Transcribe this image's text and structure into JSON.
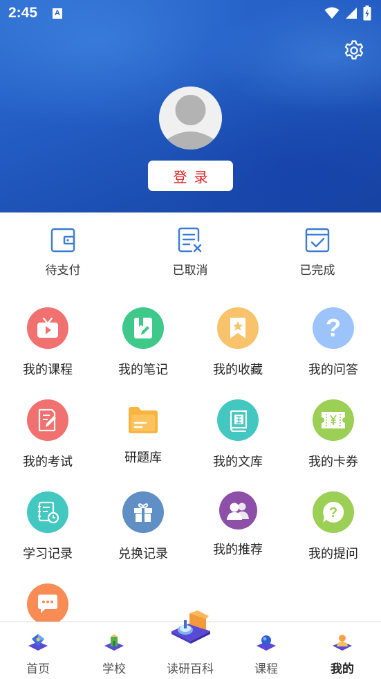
{
  "status_bar": {
    "time": "2:45",
    "notification_icon_letter": "A"
  },
  "header": {
    "settings_icon": "gear-icon",
    "avatar_icon": "default-user-avatar-icon",
    "login_label": "登录",
    "login_color": "#e02020"
  },
  "orders": [
    {
      "label": "待支付",
      "icon": "wallet-icon"
    },
    {
      "label": "已取消",
      "icon": "document-cancel-icon"
    },
    {
      "label": "已完成",
      "icon": "check-box-icon"
    }
  ],
  "menu": [
    {
      "label": "我的课程",
      "icon": "tv-play-icon",
      "color": "#f0716f"
    },
    {
      "label": "我的笔记",
      "icon": "notebook-pen-icon",
      "color": "#3ec98a"
    },
    {
      "label": "我的收藏",
      "icon": "bookmark-star-icon",
      "color": "#f8c36a"
    },
    {
      "label": "我的问答",
      "icon": "question-icon",
      "color": "#9cc4fb"
    },
    {
      "label": "我的考试",
      "icon": "exam-paper-icon",
      "color": "#f0716f"
    },
    {
      "label": "研题库",
      "icon": "folder-icon",
      "color": "#f9b43f"
    },
    {
      "label": "我的文库",
      "icon": "library-book-icon",
      "color": "#43c7c1"
    },
    {
      "label": "我的卡券",
      "icon": "coupon-icon",
      "color": "#9ccf55"
    },
    {
      "label": "学习记录",
      "icon": "study-record-icon",
      "color": "#43c7c1"
    },
    {
      "label": "兑换记录",
      "icon": "gift-icon",
      "color": "#5f8fc4"
    },
    {
      "label": "我的推荐",
      "icon": "users-icon",
      "color": "#8d4fa8"
    },
    {
      "label": "我的提问",
      "icon": "question-bubble-icon",
      "color": "#9ccf55"
    },
    {
      "label": "",
      "icon": "chat-bubble-icon",
      "color": "#f98b55"
    }
  ],
  "bottom_nav": [
    {
      "label": "首页",
      "icon": "home-cube-icon",
      "active": false
    },
    {
      "label": "学校",
      "icon": "school-cube-icon",
      "active": false
    },
    {
      "label": "读研百科",
      "icon": "encyclopedia-center-icon",
      "active": false
    },
    {
      "label": "课程",
      "icon": "course-cube-icon",
      "active": false
    },
    {
      "label": "我的",
      "icon": "mine-cube-icon",
      "active": true
    }
  ]
}
